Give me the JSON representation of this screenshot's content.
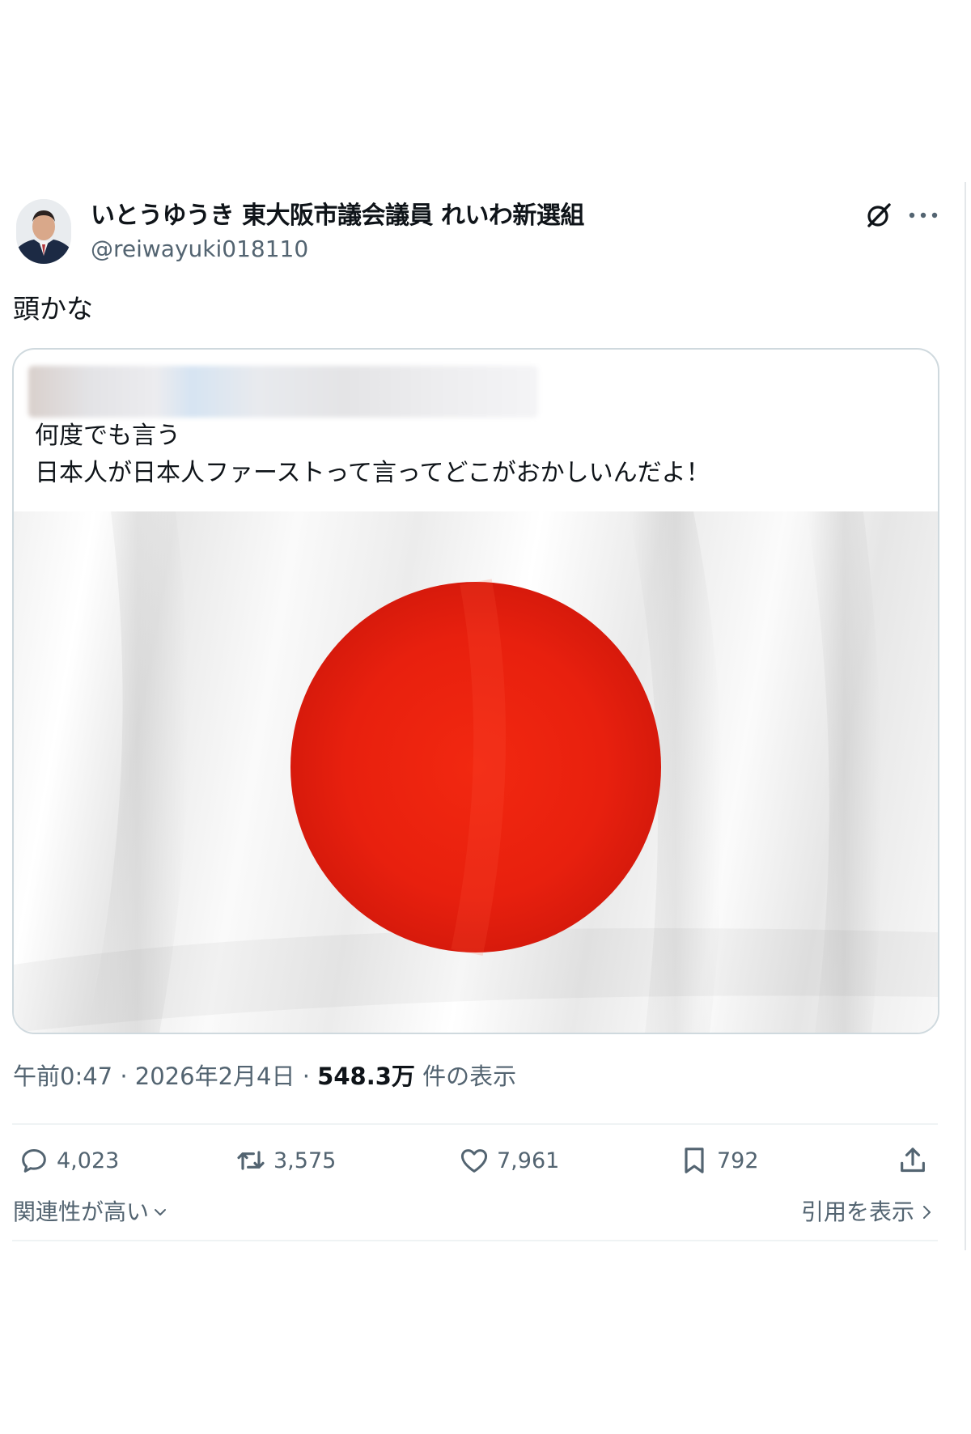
{
  "author": {
    "display_name": "いとうゆうき 東大阪市議会議員 れいわ新選組",
    "handle": "@reiwayuki018110"
  },
  "post": {
    "text": "頭かな"
  },
  "quote": {
    "lines": [
      "何度でも言う",
      "日本人が日本人ファーストって言ってどこがおかしいんだよ！"
    ]
  },
  "meta": {
    "time": "午前0:47",
    "separator": "·",
    "date": "2026年2月4日",
    "views": "548.3万",
    "views_suffix": "件の表示"
  },
  "stats": {
    "replies": "4,023",
    "reposts": "3,575",
    "likes": "7,961",
    "bookmarks": "792"
  },
  "footer": {
    "sort_label": "関連性が高い",
    "quotes_link": "引用を表示"
  },
  "icons": {
    "grok": "grok-icon",
    "more": "more-icon",
    "reply": "reply-icon",
    "repost": "repost-icon",
    "like": "heart-icon",
    "bookmark": "bookmark-icon",
    "share": "share-icon"
  },
  "colors": {
    "text_primary": "#0f1419",
    "text_secondary": "#536471",
    "border": "#cfd9de",
    "flag_red": "#e8200e"
  }
}
